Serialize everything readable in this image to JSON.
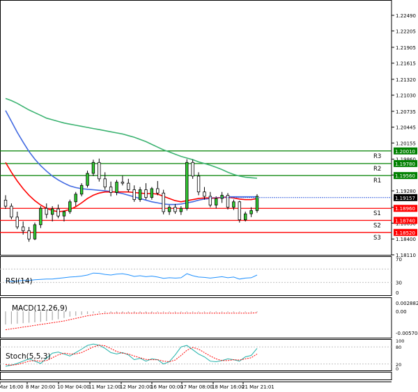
{
  "chart_data": {
    "type": "candlestick",
    "main": {
      "price_axis": {
        "ticks": [
          "1.22490",
          "1.22205",
          "1.21905",
          "1.21615",
          "1.21320",
          "1.21030",
          "1.20735",
          "1.20445",
          "1.20155",
          "1.19860",
          "1.19570",
          "1.19280",
          "1.18980",
          "1.18690",
          "1.18400",
          "1.18110"
        ],
        "ylim": [
          1.1811,
          1.2249
        ]
      },
      "current_price": "1.19157",
      "levels": [
        {
          "name": "R3",
          "value": "1.20010",
          "color": "#008000"
        },
        {
          "name": "R2",
          "value": "1.19780",
          "color": "#008000"
        },
        {
          "name": "R1",
          "value": "1.19560",
          "color": "#008000"
        },
        {
          "name": "S1",
          "value": "1.18960",
          "color": "#ff0000"
        },
        {
          "name": "S2",
          "value": "1.18740",
          "color": "#ff0000"
        },
        {
          "name": "S3",
          "value": "1.18520",
          "color": "#ff0000"
        }
      ],
      "candles": [
        [
          1.1911,
          1.192,
          1.1895,
          1.19
        ],
        [
          1.19,
          1.1905,
          1.1876,
          1.188
        ],
        [
          1.188,
          1.189,
          1.1858,
          1.1862
        ],
        [
          1.1862,
          1.1872,
          1.1848,
          1.1855
        ],
        [
          1.1855,
          1.1862,
          1.1835,
          1.184
        ],
        [
          1.184,
          1.187,
          1.1838,
          1.1866
        ],
        [
          1.1866,
          1.19,
          1.186,
          1.1896
        ],
        [
          1.1896,
          1.1905,
          1.1878,
          1.1885
        ],
        [
          1.1885,
          1.19,
          1.1872,
          1.1895
        ],
        [
          1.1895,
          1.1903,
          1.1878,
          1.1882
        ],
        [
          1.1882,
          1.1892,
          1.1872,
          1.189
        ],
        [
          1.189,
          1.1912,
          1.1886,
          1.1908
        ],
        [
          1.1908,
          1.1926,
          1.19,
          1.1922
        ],
        [
          1.1922,
          1.1942,
          1.1918,
          1.1938
        ],
        [
          1.1938,
          1.1965,
          1.1934,
          1.196
        ],
        [
          1.196,
          1.1985,
          1.1955,
          1.198
        ],
        [
          1.198,
          1.1987,
          1.1945,
          1.195
        ],
        [
          1.195,
          1.1962,
          1.193,
          1.1935
        ],
        [
          1.1935,
          1.1945,
          1.1918,
          1.1925
        ],
        [
          1.1925,
          1.1948,
          1.192,
          1.1944
        ],
        [
          1.1944,
          1.1956,
          1.1938,
          1.1942
        ],
        [
          1.1942,
          1.195,
          1.1926,
          1.193
        ],
        [
          1.193,
          1.1938,
          1.1908,
          1.1912
        ],
        [
          1.1912,
          1.1935,
          1.1908,
          1.193
        ],
        [
          1.193,
          1.1942,
          1.1912,
          1.1916
        ],
        [
          1.1916,
          1.1935,
          1.1912,
          1.1932
        ],
        [
          1.1932,
          1.1946,
          1.192,
          1.1924
        ],
        [
          1.1924,
          1.193,
          1.1885,
          1.189
        ],
        [
          1.189,
          1.1902,
          1.1884,
          1.1898
        ],
        [
          1.1898,
          1.1904,
          1.1886,
          1.189
        ],
        [
          1.189,
          1.19,
          1.1884,
          1.1896
        ],
        [
          1.1896,
          1.1986,
          1.1892,
          1.198
        ],
        [
          1.198,
          1.1985,
          1.195,
          1.1955
        ],
        [
          1.1955,
          1.1962,
          1.192,
          1.1926
        ],
        [
          1.1926,
          1.1935,
          1.1912,
          1.1918
        ],
        [
          1.1918,
          1.1926,
          1.1898,
          1.1902
        ],
        [
          1.1902,
          1.1918,
          1.1896,
          1.1914
        ],
        [
          1.1914,
          1.1926,
          1.1906,
          1.192
        ],
        [
          1.192,
          1.1924,
          1.1894,
          1.1898
        ],
        [
          1.1898,
          1.1912,
          1.1893,
          1.1908
        ],
        [
          1.1908,
          1.191,
          1.187,
          1.1875
        ],
        [
          1.1875,
          1.189,
          1.1872,
          1.1886
        ],
        [
          1.1886,
          1.1898,
          1.188,
          1.1892
        ],
        [
          1.1892,
          1.1922,
          1.1888,
          1.1918
        ]
      ],
      "ma_fast": [
        1.198,
        1.1962,
        1.1946,
        1.1932,
        1.192,
        1.191,
        1.1902,
        1.1896,
        1.1892,
        1.189,
        1.1891,
        1.1894,
        1.1899,
        1.1906,
        1.1914,
        1.192,
        1.1924,
        1.1926,
        1.1926,
        1.1926,
        1.1926,
        1.1926,
        1.1925,
        1.1924,
        1.1923,
        1.1923,
        1.1922,
        1.1918,
        1.1914,
        1.191,
        1.1908,
        1.191,
        1.1912,
        1.1914,
        1.1915,
        1.1915,
        1.1915,
        1.1916,
        1.1916,
        1.1915,
        1.1913,
        1.1912,
        1.1912,
        1.1914
      ],
      "ma_mid": [
        1.2075,
        1.2055,
        1.2035,
        1.2017,
        1.2,
        1.1986,
        1.1974,
        1.1964,
        1.1955,
        1.1948,
        1.1942,
        1.1937,
        1.1934,
        1.1932,
        1.1931,
        1.193,
        1.1929,
        1.1928,
        1.1927,
        1.1925,
        1.1923,
        1.192,
        1.1917,
        1.1914,
        1.1911,
        1.1908,
        1.1906,
        1.1904,
        1.1903,
        1.1903,
        1.1904,
        1.1906,
        1.1908,
        1.1911,
        1.1913,
        1.1914,
        1.1915,
        1.1916,
        1.1917,
        1.1917,
        1.1917,
        1.1917,
        1.1917,
        1.1917
      ],
      "ma_slow": [
        1.2097,
        1.2093,
        1.2088,
        1.2082,
        1.2076,
        1.2071,
        1.2066,
        1.2061,
        1.2058,
        1.2055,
        1.2052,
        1.205,
        1.2048,
        1.2046,
        1.2044,
        1.2042,
        1.204,
        1.2038,
        1.2036,
        1.2034,
        1.2032,
        1.2029,
        1.2026,
        1.2022,
        1.2018,
        1.2013,
        1.2008,
        1.2003,
        1.1999,
        1.1995,
        1.1991,
        1.1988,
        1.1985,
        1.1981,
        1.1978,
        1.1975,
        1.1971,
        1.1967,
        1.1962,
        1.1958,
        1.1955,
        1.1953,
        1.1952,
        1.1951
      ]
    },
    "rsi": {
      "label": "RSI(14)",
      "ticks": [
        "70",
        "30",
        "0"
      ],
      "ylim": [
        0,
        100
      ],
      "values": [
        35,
        33,
        34,
        36,
        36,
        38,
        39,
        40,
        40,
        42,
        44,
        46,
        47,
        49,
        52,
        58,
        57,
        54,
        52,
        55,
        56,
        53,
        48,
        50,
        47,
        49,
        46,
        42,
        44,
        43,
        44,
        56,
        50,
        46,
        45,
        43,
        45,
        47,
        44,
        46,
        40,
        43,
        44,
        52
      ]
    },
    "macd": {
      "label": "MACD(12,26,9)",
      "ticks": [
        "0.002882",
        "0.00",
        "-0.005704"
      ],
      "ylim": [
        -0.0057,
        0.0029
      ],
      "histogram": [
        -0.003,
        -0.0029,
        -0.0028,
        -0.0027,
        -0.0026,
        -0.0025,
        -0.0024,
        -0.0022,
        -0.002,
        -0.0018,
        -0.0015,
        -0.0012,
        -0.001,
        -0.0008,
        -0.0006,
        -0.0004,
        -0.0003,
        -0.0003,
        -0.0003,
        -0.0003,
        -0.0003,
        -0.0003,
        -0.0003,
        -0.0003,
        -0.0003,
        -0.0003,
        -0.0002,
        -0.0002,
        -0.0002,
        -0.0002,
        -0.0002,
        -0.0002,
        -0.0002,
        -0.0002,
        -0.0002,
        -0.0002,
        -0.0002,
        -0.0002,
        -0.0002,
        -0.0002,
        -0.0002,
        -0.0002,
        -0.0002,
        -0.0002
      ],
      "signal": [
        -0.0042,
        -0.004,
        -0.0038,
        -0.0036,
        -0.0034,
        -0.0032,
        -0.003,
        -0.0028,
        -0.0026,
        -0.0024,
        -0.0022,
        -0.0019,
        -0.0016,
        -0.0013,
        -0.001,
        -0.0008,
        -0.0006,
        -0.0005,
        -0.0004,
        -0.0004,
        -0.0004,
        -0.0004,
        -0.0004,
        -0.0004,
        -0.0004,
        -0.0004,
        -0.0004,
        -0.0004,
        -0.0004,
        -0.0004,
        -0.0004,
        -0.0004,
        -0.0004,
        -0.0004,
        -0.0004,
        -0.0004,
        -0.0004,
        -0.0004,
        -0.0004,
        -0.0004,
        -0.0004,
        -0.0004,
        -0.0004,
        -0.0003
      ]
    },
    "stoch": {
      "label": "Stoch(5,5,3)",
      "ticks": [
        "100",
        "80",
        "20",
        "0"
      ],
      "ylim": [
        0,
        100
      ],
      "main": [
        12,
        16,
        22,
        30,
        38,
        30,
        22,
        40,
        58,
        62,
        55,
        48,
        60,
        72,
        85,
        90,
        86,
        75,
        60,
        55,
        60,
        52,
        35,
        40,
        30,
        38,
        35,
        20,
        28,
        52,
        80,
        85,
        70,
        55,
        45,
        30,
        28,
        32,
        38,
        35,
        30,
        45,
        50,
        75
      ],
      "signal": [
        18,
        16,
        18,
        24,
        30,
        32,
        30,
        32,
        42,
        52,
        58,
        55,
        55,
        60,
        70,
        80,
        86,
        84,
        74,
        64,
        58,
        55,
        48,
        42,
        36,
        35,
        35,
        30,
        28,
        34,
        50,
        68,
        78,
        72,
        60,
        48,
        38,
        32,
        32,
        35,
        34,
        38,
        42,
        55
      ]
    },
    "time_labels": [
      "Mar 16:00",
      "8 Mar 20:00",
      "10 Mar 04:00",
      "11 Mar 12:00",
      "12 Mar 20:00",
      "16 Mar 00:00",
      "17 Mar 08:00",
      "18 Mar 16:00",
      "21 Mar 21:01"
    ]
  }
}
